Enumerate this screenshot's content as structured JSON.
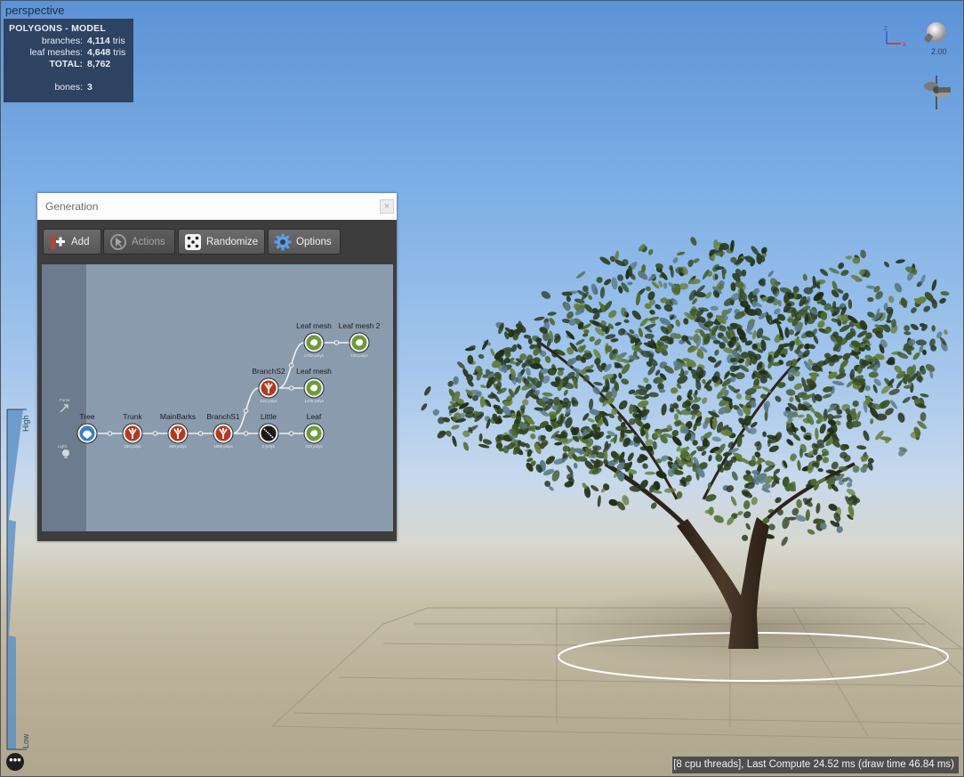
{
  "viewport": {
    "view_name": "perspective"
  },
  "stats": {
    "title": "POLYGONS - MODEL",
    "rows": [
      {
        "label": "branches:",
        "value": "4,114",
        "unit": "tris"
      },
      {
        "label": "leaf meshes:",
        "value": "4,648",
        "unit": "tris"
      },
      {
        "label": "TOTAL:",
        "value": "8,762",
        "unit": ""
      }
    ],
    "bones": {
      "label": "bones:",
      "value": "3"
    }
  },
  "gizmo": {
    "axis_z": "z",
    "axis_x": "x",
    "light_value": "2.00",
    "light_icon": "lightbulb-icon",
    "wind_icon": "fan-icon"
  },
  "generation": {
    "title": "Generation",
    "close_icon": "close-icon",
    "toolbar": [
      {
        "label": "Add",
        "icon": "add-node-icon",
        "enabled": true
      },
      {
        "label": "Actions",
        "icon": "pointer-icon",
        "enabled": false
      },
      {
        "label": "Randomize",
        "icon": "dice-icon",
        "enabled": true
      },
      {
        "label": "Options",
        "icon": "gear-icon",
        "enabled": true
      }
    ],
    "strip_labels": [
      "Force",
      "Light"
    ],
    "nodes": [
      {
        "id": "tree",
        "label": "Tree",
        "kind": "root",
        "sub": ""
      },
      {
        "id": "trunk",
        "label": "Trunk",
        "kind": "branch",
        "sub": "280 polys"
      },
      {
        "id": "mainbarks",
        "label": "MainBarks",
        "kind": "branch",
        "sub": "640 polys"
      },
      {
        "id": "branchs1",
        "label": "BranchS1",
        "kind": "branch",
        "sub": "1858 polys"
      },
      {
        "id": "little",
        "label": "Little",
        "kind": "frond",
        "sub": "0 polys"
      },
      {
        "id": "leaf",
        "label": "Leaf",
        "kind": "leaf",
        "sub": "228 polys"
      },
      {
        "id": "branchs2",
        "label": "BranchS2",
        "kind": "branch",
        "sub": "616 polys"
      },
      {
        "id": "leafmesh_a",
        "label": "Leaf mesh",
        "kind": "leaf",
        "sub": "1476 polys"
      },
      {
        "id": "leafmesh_b",
        "label": "Leaf mesh",
        "kind": "leaf",
        "sub": "2782 polys"
      },
      {
        "id": "leafmesh2",
        "label": "Leaf mesh 2",
        "kind": "leaf",
        "sub": "158 polys"
      }
    ]
  },
  "lod": {
    "high_label": "High",
    "low_label": "Low",
    "menu_icon": "more-dots-icon",
    "menu_symbol": "•••"
  },
  "status": {
    "text": "[8 cpu threads], Last Compute 24.52 ms (draw time 46.84 ms)"
  },
  "colors": {
    "branch_node": "#b03a22",
    "leaf_node": "#6f9a3c",
    "root_node": "#3a7fc0",
    "frond_node": "#1a1a1a",
    "panel_bg": "#3d3d3d",
    "graph_bg": "#8a9bae"
  }
}
